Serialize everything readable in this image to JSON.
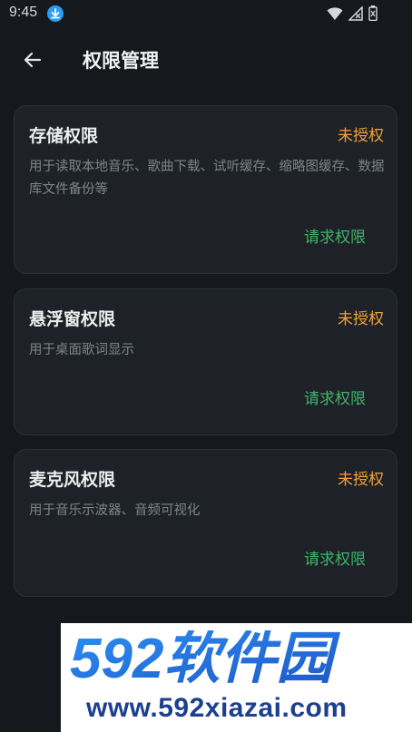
{
  "status_bar": {
    "time": "9:45",
    "icons": [
      "download-icon",
      "wifi-icon",
      "signal-icon",
      "battery-icon"
    ]
  },
  "header": {
    "title": "权限管理",
    "back_icon": "arrow-left-icon"
  },
  "permissions": [
    {
      "title": "存储权限",
      "status": "未授权",
      "description": "用于读取本地音乐、歌曲下载、试听缓存、缩略图缓存、数据库文件备份等",
      "action": "请求权限"
    },
    {
      "title": "悬浮窗权限",
      "status": "未授权",
      "description": "用于桌面歌词显示",
      "action": "请求权限"
    },
    {
      "title": "麦克风权限",
      "status": "未授权",
      "description": "用于音乐示波器、音频可视化",
      "action": "请求权限"
    }
  ],
  "colors": {
    "background": "#15181d",
    "card": "#1e2228",
    "status_unauthorized": "#f0a13a",
    "action": "#3fb36a"
  },
  "watermark": {
    "logo_text": "592软件园",
    "url": "www.592xiazai.com"
  }
}
